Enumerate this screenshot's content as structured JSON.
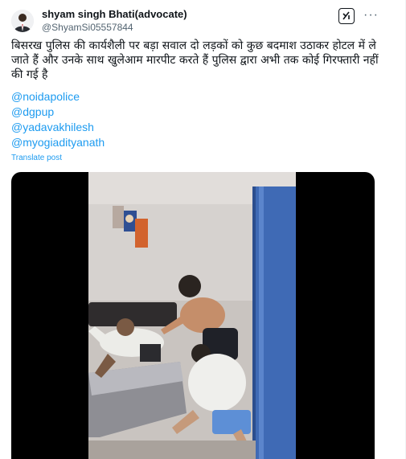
{
  "author": {
    "name": "shyam singh Bhati(advocate)",
    "handle": "@ShyamSi05557844"
  },
  "post": {
    "text": "बिसरख पुलिस की कार्यशैली पर बड़ा सवाल दो लड़कों को कुछ बदमाश उठाकर होटल में ले जाते हैं और उनके साथ खुलेआम मारपीट करते हैं पुलिस द्वारा अभी तक कोई गिरफ्तारी नहीं की गई है",
    "mentions": [
      "@noidapolice",
      "@dgpup",
      "@yadavakhilesh",
      "@myogiadityanath"
    ],
    "translate_label": "Translate post"
  },
  "icons": {
    "grok": "grok-icon",
    "more": "more-options-icon",
    "avatar": "user-avatar"
  },
  "colors": {
    "link": "#1d9bf0",
    "text": "#0f1419",
    "muted": "#536471"
  }
}
